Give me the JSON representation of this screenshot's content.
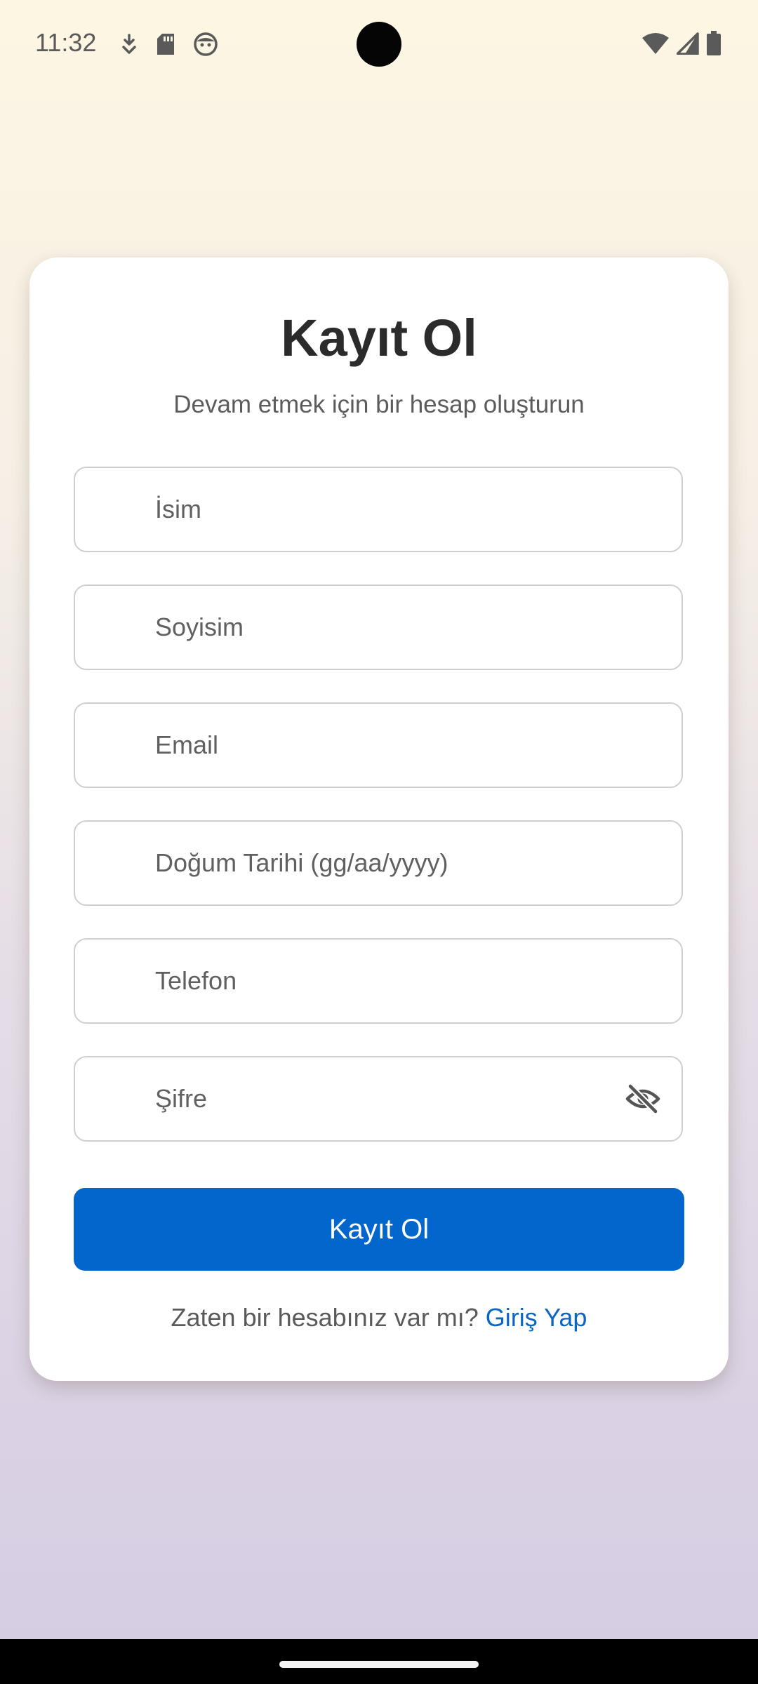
{
  "status_bar": {
    "time": "11:32",
    "left_icons": [
      "download-icon",
      "sd-card-icon",
      "face-icon"
    ],
    "right_icons": [
      "wifi-icon",
      "signal-icon",
      "battery-icon"
    ]
  },
  "form": {
    "title": "Kayıt Ol",
    "subtitle": "Devam etmek için bir hesap oluşturun",
    "fields": [
      {
        "name": "first-name",
        "placeholder": "İsim"
      },
      {
        "name": "last-name",
        "placeholder": "Soyisim"
      },
      {
        "name": "email",
        "placeholder": "Email"
      },
      {
        "name": "birth-date",
        "placeholder": "Doğum Tarihi (gg/aa/yyyy)"
      },
      {
        "name": "phone",
        "placeholder": "Telefon"
      },
      {
        "name": "password",
        "placeholder": "Şifre",
        "icon": "eye-off-icon"
      }
    ],
    "submit_label": "Kayıt Ol",
    "login_prompt": "Zaten bir hesabınız var mı?",
    "login_link": "Giriş Yap"
  },
  "colors": {
    "primary": "#0366cc",
    "link": "#0a66c2",
    "title": "#2b2b2b",
    "border": "#cfcfcf"
  }
}
